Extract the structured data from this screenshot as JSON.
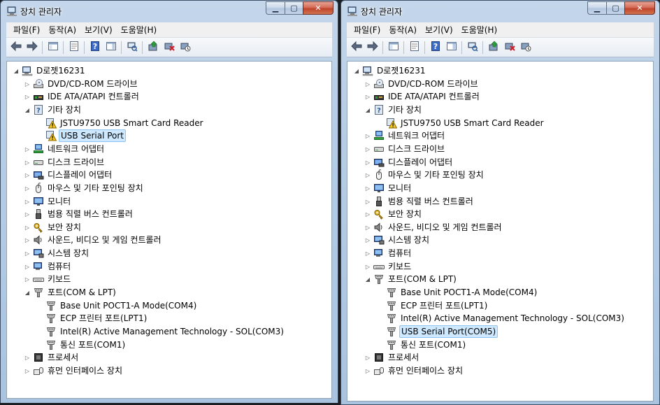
{
  "windows": [
    {
      "id": "left",
      "title": "장치 관리자",
      "menu": [
        "파일(F)",
        "동작(A)",
        "보기(V)",
        "도움말(H)"
      ],
      "computer": "D로젯16231",
      "tree": [
        {
          "label": "DVD/CD-ROM 드라이브",
          "icon": "dvd-drive-icon",
          "state": "collapsed"
        },
        {
          "label": "IDE ATA/ATAPI 컨트롤러",
          "icon": "ide-controller-icon",
          "state": "collapsed"
        },
        {
          "label": "기타 장치",
          "icon": "other-devices-icon",
          "state": "expanded",
          "children": [
            {
              "label": "JSTU9750 USB Smart Card Reader",
              "icon": "warning-device-icon"
            },
            {
              "label": "USB Serial Port",
              "icon": "warning-device-icon",
              "selected": true
            }
          ]
        },
        {
          "label": "네트워크 어댑터",
          "icon": "network-adapter-icon",
          "state": "collapsed"
        },
        {
          "label": "디스크 드라이브",
          "icon": "disk-drive-icon",
          "state": "collapsed"
        },
        {
          "label": "디스플레이 어댑터",
          "icon": "display-adapter-icon",
          "state": "collapsed"
        },
        {
          "label": "마우스 및 기타 포인팅 장치",
          "icon": "mouse-icon",
          "state": "collapsed"
        },
        {
          "label": "모니터",
          "icon": "monitor-icon",
          "state": "collapsed"
        },
        {
          "label": "범용 직렬 버스 컨트롤러",
          "icon": "usb-controller-icon",
          "state": "collapsed"
        },
        {
          "label": "보안 장치",
          "icon": "security-key-icon",
          "state": "collapsed"
        },
        {
          "label": "사운드, 비디오 및 게임 컨트롤러",
          "icon": "speaker-icon",
          "state": "collapsed"
        },
        {
          "label": "시스템 장치",
          "icon": "system-device-icon",
          "state": "collapsed"
        },
        {
          "label": "컴퓨터",
          "icon": "computer-icon",
          "state": "collapsed"
        },
        {
          "label": "키보드",
          "icon": "keyboard-icon",
          "state": "collapsed"
        },
        {
          "label": "포트(COM & LPT)",
          "icon": "port-icon",
          "state": "expanded",
          "children": [
            {
              "label": "Base Unit POCT1-A Mode(COM4)",
              "icon": "port-icon"
            },
            {
              "label": "ECP 프린터 포트(LPT1)",
              "icon": "port-icon"
            },
            {
              "label": "Intel(R) Active Management Technology - SOL(COM3)",
              "icon": "port-icon"
            },
            {
              "label": "통신 포트(COM1)",
              "icon": "port-icon"
            }
          ]
        },
        {
          "label": "프로세서",
          "icon": "processor-icon",
          "state": "collapsed"
        },
        {
          "label": "휴먼 인터페이스 장치",
          "icon": "hid-icon",
          "state": "collapsed"
        }
      ]
    },
    {
      "id": "right",
      "title": "장치 관리자",
      "menu": [
        "파일(F)",
        "동작(A)",
        "보기(V)",
        "도움말(H)"
      ],
      "computer": "D로젯16231",
      "tree": [
        {
          "label": "DVD/CD-ROM 드라이브",
          "icon": "dvd-drive-icon",
          "state": "collapsed"
        },
        {
          "label": "IDE ATA/ATAPI 컨트롤러",
          "icon": "ide-controller-icon",
          "state": "collapsed"
        },
        {
          "label": "기타 장치",
          "icon": "other-devices-icon",
          "state": "expanded",
          "children": [
            {
              "label": "JSTU9750 USB Smart Card Reader",
              "icon": "warning-device-icon"
            }
          ]
        },
        {
          "label": "네트워크 어댑터",
          "icon": "network-adapter-icon",
          "state": "collapsed"
        },
        {
          "label": "디스크 드라이브",
          "icon": "disk-drive-icon",
          "state": "collapsed"
        },
        {
          "label": "디스플레이 어댑터",
          "icon": "display-adapter-icon",
          "state": "collapsed"
        },
        {
          "label": "마우스 및 기타 포인팅 장치",
          "icon": "mouse-icon",
          "state": "collapsed"
        },
        {
          "label": "모니터",
          "icon": "monitor-icon",
          "state": "collapsed"
        },
        {
          "label": "범용 직렬 버스 컨트롤러",
          "icon": "usb-controller-icon",
          "state": "collapsed"
        },
        {
          "label": "보안 장치",
          "icon": "security-key-icon",
          "state": "collapsed"
        },
        {
          "label": "사운드, 비디오 및 게임 컨트롤러",
          "icon": "speaker-icon",
          "state": "collapsed"
        },
        {
          "label": "시스템 장치",
          "icon": "system-device-icon",
          "state": "collapsed"
        },
        {
          "label": "컴퓨터",
          "icon": "computer-icon",
          "state": "collapsed"
        },
        {
          "label": "키보드",
          "icon": "keyboard-icon",
          "state": "collapsed"
        },
        {
          "label": "포트(COM & LPT)",
          "icon": "port-icon",
          "state": "expanded",
          "children": [
            {
              "label": "Base Unit POCT1-A Mode(COM4)",
              "icon": "port-icon"
            },
            {
              "label": "ECP 프린터 포트(LPT1)",
              "icon": "port-icon"
            },
            {
              "label": "Intel(R) Active Management Technology - SOL(COM3)",
              "icon": "port-icon"
            },
            {
              "label": "USB Serial Port(COM5)",
              "icon": "port-icon",
              "selected": true
            },
            {
              "label": "통신 포트(COM1)",
              "icon": "port-icon"
            }
          ]
        },
        {
          "label": "프로세서",
          "icon": "processor-icon",
          "state": "collapsed"
        },
        {
          "label": "휴먼 인터페이스 장치",
          "icon": "hid-icon",
          "state": "collapsed"
        }
      ]
    }
  ],
  "toolbar_icons": [
    "back-arrow-icon",
    "forward-arrow-icon",
    "show-hide-console-tree-icon",
    "properties-icon",
    "help-icon",
    "action-pane-icon",
    "scan-hardware-icon",
    "update-driver-icon",
    "uninstall-icon",
    "disable-device-icon"
  ],
  "colors": {
    "selection_bg": "#cde8ff",
    "selection_border": "#8fc3f0",
    "close_button": "#c0432c",
    "frame": "#b7cde6"
  }
}
